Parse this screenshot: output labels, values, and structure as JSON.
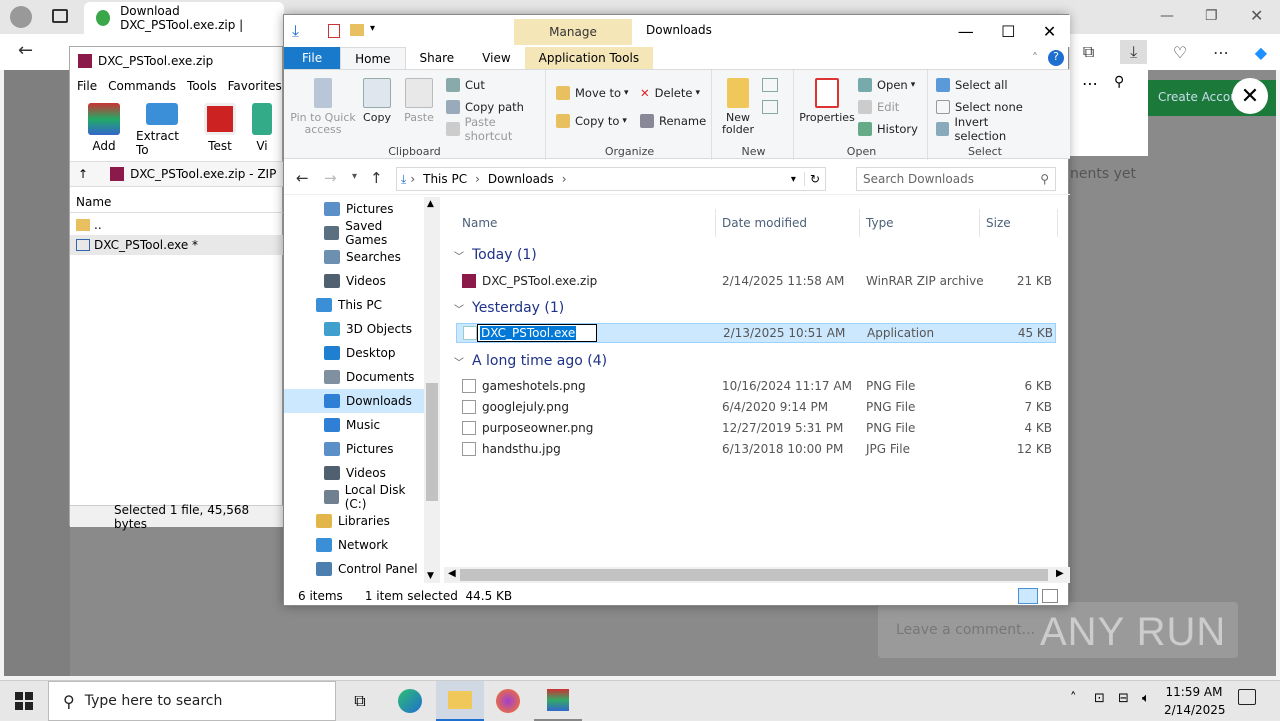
{
  "browser": {
    "tab_title": "Download DXC_PSTool.exe.zip |",
    "green_button": "Create Accou",
    "right_text": "nents yet",
    "comment_placeholder": "Leave a comment..."
  },
  "watermark": "ANY RUN",
  "winrar": {
    "title": "DXC_PSTool.exe.zip",
    "menu": [
      "File",
      "Commands",
      "Tools",
      "Favorites"
    ],
    "tools": [
      "Add",
      "Extract To",
      "Test",
      "Vi"
    ],
    "path": "DXC_PSTool.exe.zip - ZIP",
    "col_name": "Name",
    "rows": [
      "..",
      "DXC_PSTool.exe *"
    ],
    "status": "Selected 1 file, 45,568 bytes"
  },
  "explorer": {
    "manage": "Manage",
    "title": "Downloads",
    "tabs": {
      "file": "File",
      "home": "Home",
      "share": "Share",
      "view": "View",
      "apptools": "Application Tools"
    },
    "ribbon": {
      "pin": "Pin to Quick access",
      "copy": "Copy",
      "paste": "Paste",
      "cut": "Cut",
      "copy_path": "Copy path",
      "paste_shortcut": "Paste shortcut",
      "clipboard": "Clipboard",
      "move_to": "Move to",
      "copy_to": "Copy to",
      "delete": "Delete",
      "rename": "Rename",
      "organize": "Organize",
      "new_folder": "New folder",
      "new": "New",
      "properties": "Properties",
      "open": "Open",
      "edit": "Edit",
      "history": "History",
      "open_group": "Open",
      "select_all": "Select all",
      "select_none": "Select none",
      "invert": "Invert selection",
      "select_group": "Select"
    },
    "address": {
      "this_pc": "This PC",
      "downloads": "Downloads"
    },
    "search_placeholder": "Search Downloads",
    "nav": [
      {
        "label": "Pictures",
        "color": "#5a8fc7"
      },
      {
        "label": "Saved Games",
        "color": "#5a7080"
      },
      {
        "label": "Searches",
        "color": "#6d8fb0"
      },
      {
        "label": "Videos",
        "color": "#506070"
      },
      {
        "label": "This PC",
        "color": "#3b8ed8"
      },
      {
        "label": "3D Objects",
        "color": "#3fa0d0"
      },
      {
        "label": "Desktop",
        "color": "#1f7fd0"
      },
      {
        "label": "Documents",
        "color": "#8090a0"
      },
      {
        "label": "Downloads",
        "color": "#2f7fd6"
      },
      {
        "label": "Music",
        "color": "#2f7fd6"
      },
      {
        "label": "Pictures",
        "color": "#5a8fc7"
      },
      {
        "label": "Videos",
        "color": "#506070"
      },
      {
        "label": "Local Disk (C:)",
        "color": "#708090"
      },
      {
        "label": "Libraries",
        "color": "#e3b64b"
      },
      {
        "label": "Network",
        "color": "#3b8ed8"
      },
      {
        "label": "Control Panel",
        "color": "#4a7fb0"
      }
    ],
    "columns": {
      "name": "Name",
      "date": "Date modified",
      "type": "Type",
      "size": "Size"
    },
    "groups": {
      "today": "Today (1)",
      "yesterday": "Yesterday (1)",
      "longago": "A long time ago (4)"
    },
    "files": {
      "zip": {
        "name": "DXC_PSTool.exe.zip",
        "date": "2/14/2025 11:58 AM",
        "type": "WinRAR ZIP archive",
        "size": "21 KB"
      },
      "exe": {
        "name": "DXC_PSTool.exe",
        "date": "2/13/2025 10:51 AM",
        "type": "Application",
        "size": "45 KB"
      },
      "old": [
        {
          "name": "gameshotels.png",
          "date": "10/16/2024 11:17 AM",
          "type": "PNG File",
          "size": "6 KB"
        },
        {
          "name": "googlejuly.png",
          "date": "6/4/2020 9:14 PM",
          "type": "PNG File",
          "size": "7 KB"
        },
        {
          "name": "purposeowner.png",
          "date": "12/27/2019 5:31 PM",
          "type": "PNG File",
          "size": "4 KB"
        },
        {
          "name": "handsthu.jpg",
          "date": "6/13/2018 10:00 PM",
          "type": "JPG File",
          "size": "12 KB"
        }
      ]
    },
    "status": {
      "items": "6 items",
      "selected": "1 item selected",
      "size": "44.5 KB"
    }
  },
  "taskbar": {
    "search_placeholder": "Type here to search",
    "time": "11:59 AM",
    "date": "2/14/2025"
  }
}
